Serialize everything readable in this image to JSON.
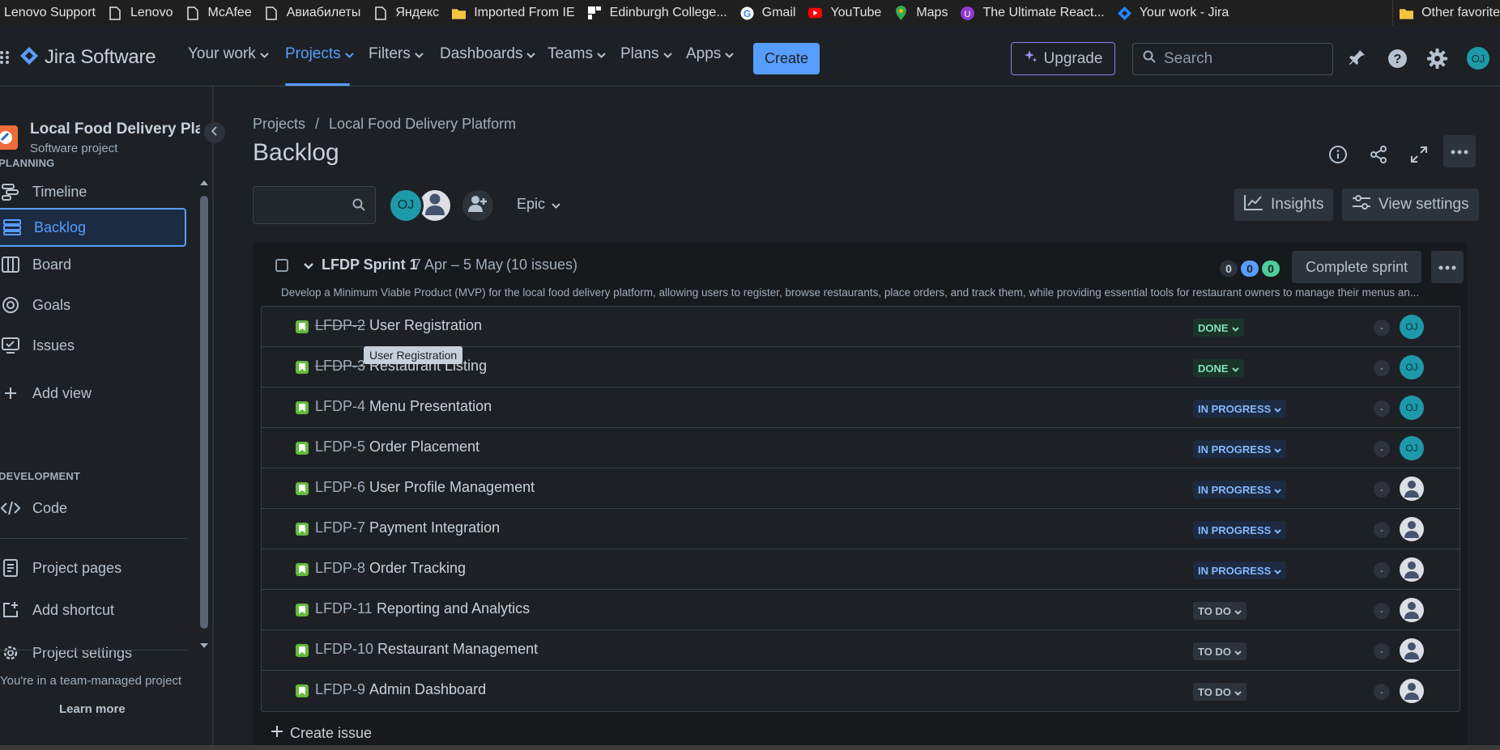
{
  "bookmarks": [
    {
      "label": "Lenovo Support",
      "icon": "none"
    },
    {
      "label": "Lenovo",
      "icon": "page-icon"
    },
    {
      "label": "McAfee",
      "icon": "page-icon"
    },
    {
      "label": "Авиабилеты",
      "icon": "page-icon"
    },
    {
      "label": "Яндекс",
      "icon": "page-icon"
    },
    {
      "label": "Imported From IE",
      "icon": "folder-icon"
    },
    {
      "label": "Edinburgh College...",
      "icon": "edinburgh-icon"
    },
    {
      "label": "Gmail",
      "icon": "google-icon"
    },
    {
      "label": "YouTube",
      "icon": "youtube-icon"
    },
    {
      "label": "Maps",
      "icon": "maps-icon"
    },
    {
      "label": "The Ultimate React...",
      "icon": "react-course-icon"
    },
    {
      "label": "Your work - Jira",
      "icon": "jira-icon"
    }
  ],
  "other_favorites": "Other favorite",
  "nav": {
    "logo": "Jira Software",
    "items": [
      "Your work",
      "Projects",
      "Filters",
      "Dashboards",
      "Teams",
      "Plans",
      "Apps"
    ],
    "active": "Projects",
    "create": "Create",
    "upgrade": "Upgrade",
    "search_placeholder": "Search",
    "avatar": "OJ"
  },
  "sidebar": {
    "project_name": "Local Food Delivery Plat...",
    "project_type": "Software project",
    "planning_label": "PLANNING",
    "planning_items": [
      "Timeline",
      "Backlog",
      "Board",
      "Goals",
      "Issues"
    ],
    "add_view": "Add view",
    "development_label": "DEVELOPMENT",
    "code": "Code",
    "project_pages": "Project pages",
    "add_shortcut": "Add shortcut",
    "project_settings": "Project settings",
    "footer": "You're in a team-managed project",
    "learn_more": "Learn more"
  },
  "main": {
    "breadcrumb": [
      "Projects",
      "/",
      "Local Food Delivery Platform"
    ],
    "title": "Backlog",
    "avatar_initials": "OJ",
    "epic": "Epic",
    "insights": "Insights",
    "view_settings": "View settings"
  },
  "sprint": {
    "name": "LFDP Sprint 1",
    "dates": "7 Apr – 5 May",
    "count": "(10 issues)",
    "goal": "Develop a Minimum Viable Product (MVP) for the local food delivery platform, allowing users to register, browse restaurants, place orders, and track them, while providing essential tools for restaurant owners to manage their menus an...",
    "counts": {
      "todo": "0",
      "in_progress": "0",
      "done": "0"
    },
    "complete": "Complete sprint",
    "issues": [
      {
        "key": "LFDP-2",
        "summary": "User Registration",
        "status": "DONE",
        "assignee": "OJ"
      },
      {
        "key": "LFDP-3",
        "summary": "Restaurant Listing",
        "status": "DONE",
        "assignee": "OJ"
      },
      {
        "key": "LFDP-4",
        "summary": "Menu Presentation",
        "status": "IN PROGRESS",
        "assignee": "OJ"
      },
      {
        "key": "LFDP-5",
        "summary": "Order Placement",
        "status": "IN PROGRESS",
        "assignee": "OJ"
      },
      {
        "key": "LFDP-6",
        "summary": "User Profile Management",
        "status": "IN PROGRESS",
        "assignee": ""
      },
      {
        "key": "LFDP-7",
        "summary": "Payment Integration",
        "status": "IN PROGRESS",
        "assignee": ""
      },
      {
        "key": "LFDP-8",
        "summary": "Order Tracking",
        "status": "IN PROGRESS",
        "assignee": ""
      },
      {
        "key": "LFDP-11",
        "summary": "Reporting and Analytics",
        "status": "TO DO",
        "assignee": ""
      },
      {
        "key": "LFDP-10",
        "summary": "Restaurant Management",
        "status": "TO DO",
        "assignee": ""
      },
      {
        "key": "LFDP-9",
        "summary": "Admin Dashboard",
        "status": "TO DO",
        "assignee": ""
      }
    ],
    "estimate": "-",
    "tooltip": "User Registration",
    "create_issue": "Create issue"
  },
  "colors": {
    "accent": "#579dff",
    "done": "#7ee2b8",
    "in_progress": "#85b8ff",
    "background": "#1d2125"
  }
}
